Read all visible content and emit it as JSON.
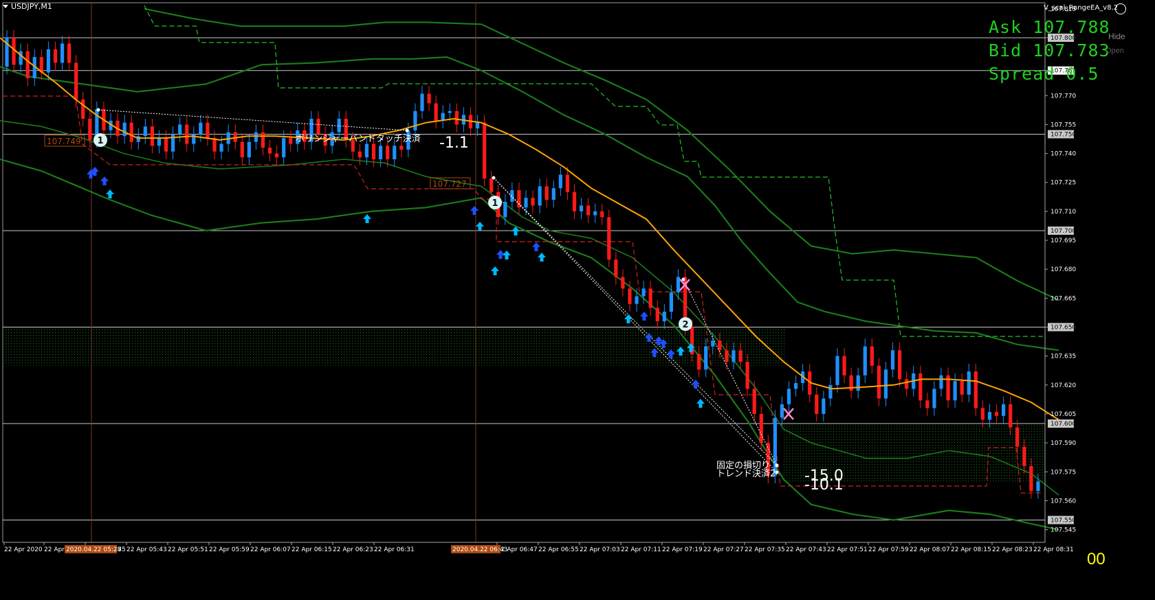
{
  "window": {
    "symbol_label": "USDJPY,M1",
    "ea_name": "V_scal_RangeEA_v8.2"
  },
  "quote_panel": {
    "ask": "Ask 107.788",
    "bid": "Bid 107.783",
    "spread": "Spread 0.5",
    "hide": "Hide",
    "open": "Open"
  },
  "price_axis": {
    "min": 107.542,
    "max": 107.816,
    "labels": [
      "107.815",
      "107.800",
      "107.783",
      "107.770",
      "107.755",
      "107.740",
      "107.725",
      "107.710",
      "107.695",
      "107.680",
      "107.665",
      "107.650",
      "107.635",
      "107.620",
      "107.605",
      "107.590",
      "107.575",
      "107.560",
      "107.545"
    ],
    "boxed": [
      "107.800",
      "107.783",
      "107.750",
      "107.700",
      "107.650",
      "107.600",
      "107.550"
    ]
  },
  "time_axis": {
    "labels": [
      "22 Apr 2020",
      "22 Apr",
      "22 Apr 05:35",
      "22 Apr 05:43",
      "22 Apr 05:51",
      "22 Apr 05:59",
      "22 Apr 06:07",
      "22 Apr 06:15",
      "22 Apr 06:23",
      "22 Apr 06:31",
      "22 Apr 06:47",
      "22 Apr 06:55",
      "22 Apr 07:03",
      "22 Apr 07:11",
      "22 Apr 07:19",
      "22 Apr 07:27",
      "22 Apr 07:35",
      "22 Apr 07:43",
      "22 Apr 07:51",
      "22 Apr 07:59",
      "22 Apr 08:07",
      "22 Apr 08:15",
      "22 Apr 08:23",
      "22 Apr 08:31"
    ],
    "highlight_1": "2020.04.22 05:28",
    "highlight_1_suffix": "7",
    "highlight_2": "2020.04.22 06:43"
  },
  "annotations": {
    "price_tag_1": "107.749",
    "price_tag_2": "107.727",
    "exit_label_1": "ボリンジャーバンドタッチ決済",
    "profit_1": "-1.1",
    "stop_label": "固定の損切り",
    "trend_label": "トレンド決済2",
    "profit_2": "-15.0",
    "profit_3": "-10.1",
    "badge_1": "1",
    "badge_2": "1",
    "badge_3": "2",
    "counter": "00"
  },
  "colors": {
    "up_candle": "#1e90ff",
    "down_candle": "#ff1a1a",
    "ma": "#ffa500",
    "band": "#1a7a1a",
    "grid": "#c8c8c8",
    "quote": "#1fd01f"
  },
  "chart_data": {
    "type": "candlestick",
    "symbol": "USDJPY",
    "timeframe": "M1",
    "ylim": [
      107.542,
      107.816
    ],
    "ma_line": [
      [
        0,
        107.8
      ],
      [
        40,
        107.788
      ],
      [
        80,
        107.777
      ],
      [
        110,
        107.768
      ],
      [
        140,
        107.76
      ],
      [
        170,
        107.753
      ],
      [
        200,
        107.748
      ],
      [
        240,
        107.748
      ],
      [
        280,
        107.749
      ],
      [
        320,
        107.747
      ],
      [
        360,
        107.749
      ],
      [
        400,
        107.749
      ],
      [
        450,
        107.748
      ],
      [
        500,
        107.747
      ],
      [
        540,
        107.749
      ],
      [
        580,
        107.752
      ],
      [
        620,
        107.756
      ],
      [
        660,
        107.758
      ],
      [
        700,
        107.756
      ],
      [
        740,
        107.75
      ],
      [
        780,
        107.742
      ],
      [
        820,
        107.733
      ],
      [
        860,
        107.722
      ],
      [
        900,
        107.714
      ],
      [
        940,
        107.706
      ],
      [
        980,
        107.69
      ],
      [
        1020,
        107.675
      ],
      [
        1060,
        107.66
      ],
      [
        1100,
        107.645
      ],
      [
        1140,
        107.632
      ],
      [
        1180,
        107.621
      ],
      [
        1210,
        107.618
      ],
      [
        1260,
        107.619
      ],
      [
        1300,
        107.62
      ],
      [
        1340,
        107.623
      ],
      [
        1380,
        107.623
      ],
      [
        1420,
        107.622
      ],
      [
        1460,
        107.617
      ],
      [
        1500,
        107.611
      ],
      [
        1540,
        107.602
      ]
    ],
    "upper_band": [
      [
        0,
        107.785
      ],
      [
        40,
        107.78
      ],
      [
        100,
        107.777
      ],
      [
        200,
        107.772
      ],
      [
        300,
        107.776
      ],
      [
        380,
        107.786
      ],
      [
        460,
        107.787
      ],
      [
        540,
        107.789
      ],
      [
        600,
        107.789
      ],
      [
        650,
        107.79
      ],
      [
        700,
        107.783
      ],
      [
        760,
        107.772
      ],
      [
        820,
        107.76
      ],
      [
        880,
        107.75
      ],
      [
        940,
        107.738
      ],
      [
        1000,
        107.728
      ],
      [
        1040,
        107.713
      ],
      [
        1080,
        107.694
      ],
      [
        1120,
        107.678
      ],
      [
        1160,
        107.663
      ],
      [
        1200,
        107.658
      ],
      [
        1260,
        107.653
      ],
      [
        1300,
        107.651
      ],
      [
        1360,
        107.648
      ],
      [
        1420,
        107.647
      ],
      [
        1480,
        107.641
      ],
      [
        1540,
        107.638
      ]
    ],
    "lower_band": [
      [
        0,
        107.737
      ],
      [
        60,
        107.731
      ],
      [
        120,
        107.722
      ],
      [
        160,
        107.716
      ],
      [
        220,
        107.708
      ],
      [
        300,
        107.7
      ],
      [
        380,
        107.704
      ],
      [
        460,
        107.706
      ],
      [
        540,
        107.71
      ],
      [
        620,
        107.712
      ],
      [
        700,
        107.717
      ],
      [
        740,
        107.704
      ],
      [
        800,
        107.694
      ],
      [
        860,
        107.686
      ],
      [
        920,
        107.67
      ],
      [
        980,
        107.651
      ],
      [
        1040,
        107.625
      ],
      [
        1090,
        107.6
      ],
      [
        1140,
        107.571
      ],
      [
        1180,
        107.558
      ],
      [
        1240,
        107.553
      ],
      [
        1300,
        107.55
      ],
      [
        1380,
        107.555
      ],
      [
        1440,
        107.553
      ],
      [
        1500,
        107.548
      ],
      [
        1540,
        107.545
      ]
    ],
    "outer_upper_band": [
      [
        210,
        107.815
      ],
      [
        280,
        107.81
      ],
      [
        350,
        107.806
      ],
      [
        420,
        107.806
      ],
      [
        500,
        107.806
      ],
      [
        560,
        107.808
      ],
      [
        620,
        107.808
      ],
      [
        700,
        107.807
      ],
      [
        760,
        107.797
      ],
      [
        820,
        107.787
      ],
      [
        880,
        107.778
      ],
      [
        940,
        107.768
      ],
      [
        1000,
        107.752
      ],
      [
        1060,
        107.732
      ],
      [
        1120,
        107.71
      ],
      [
        1180,
        107.692
      ],
      [
        1240,
        107.688
      ],
      [
        1300,
        107.69
      ],
      [
        1360,
        107.688
      ],
      [
        1420,
        107.686
      ],
      [
        1480,
        107.674
      ],
      [
        1540,
        107.664
      ]
    ],
    "inner_lower_band": [
      [
        0,
        107.757
      ],
      [
        60,
        107.754
      ],
      [
        120,
        107.748
      ],
      [
        180,
        107.74
      ],
      [
        240,
        107.735
      ],
      [
        320,
        107.732
      ],
      [
        420,
        107.734
      ],
      [
        500,
        107.737
      ],
      [
        560,
        107.735
      ],
      [
        620,
        107.728
      ],
      [
        700,
        107.723
      ],
      [
        760,
        107.707
      ],
      [
        800,
        107.7
      ],
      [
        860,
        107.696
      ],
      [
        920,
        107.686
      ],
      [
        980,
        107.668
      ],
      [
        1040,
        107.645
      ],
      [
        1100,
        107.618
      ],
      [
        1140,
        107.597
      ],
      [
        1180,
        107.59
      ],
      [
        1260,
        107.582
      ],
      [
        1320,
        107.582
      ],
      [
        1380,
        107.586
      ],
      [
        1440,
        107.583
      ],
      [
        1500,
        107.574
      ],
      [
        1540,
        107.563
      ]
    ],
    "candles": [
      [
        107.785,
        107.8
      ],
      [
        107.8,
        107.786
      ],
      [
        107.786,
        107.793
      ],
      [
        107.793,
        107.779
      ],
      [
        107.779,
        107.79
      ],
      [
        107.79,
        107.782
      ],
      [
        107.782,
        107.794
      ],
      [
        107.794,
        107.787
      ],
      [
        107.787,
        107.797
      ],
      [
        107.797,
        107.787
      ],
      [
        107.787,
        107.768
      ],
      [
        107.768,
        107.758
      ],
      [
        107.758,
        107.747
      ],
      [
        107.747,
        107.763
      ],
      [
        107.763,
        107.752
      ],
      [
        107.752,
        107.757
      ],
      [
        107.757,
        107.749
      ],
      [
        107.749,
        107.756
      ],
      [
        107.756,
        107.746
      ],
      [
        107.746,
        107.749
      ],
      [
        107.749,
        107.754
      ],
      [
        107.754,
        107.744
      ],
      [
        107.744,
        107.748
      ],
      [
        107.748,
        107.741
      ],
      [
        107.741,
        107.75
      ],
      [
        107.75,
        107.755
      ],
      [
        107.755,
        107.745
      ],
      [
        107.745,
        107.75
      ],
      [
        107.75,
        107.756
      ],
      [
        107.756,
        107.748
      ],
      [
        107.748,
        107.741
      ],
      [
        107.741,
        107.745
      ],
      [
        107.745,
        107.751
      ],
      [
        107.751,
        107.746
      ],
      [
        107.746,
        107.738
      ],
      [
        107.738,
        107.746
      ],
      [
        107.746,
        107.751
      ],
      [
        107.751,
        107.743
      ],
      [
        107.743,
        107.74
      ],
      [
        107.74,
        107.738
      ],
      [
        107.738,
        107.748
      ],
      [
        107.748,
        107.745
      ],
      [
        107.745,
        107.752
      ],
      [
        107.752,
        107.746
      ],
      [
        107.746,
        107.758
      ],
      [
        107.758,
        107.75
      ],
      [
        107.75,
        107.744
      ],
      [
        107.744,
        107.751
      ],
      [
        107.751,
        107.758
      ],
      [
        107.758,
        107.747
      ],
      [
        107.747,
        107.741
      ],
      [
        107.741,
        107.738
      ],
      [
        107.738,
        107.745
      ],
      [
        107.745,
        107.737
      ],
      [
        107.737,
        107.744
      ],
      [
        107.744,
        107.737
      ],
      [
        107.737,
        107.744
      ],
      [
        107.744,
        107.742
      ],
      [
        107.742,
        107.752
      ],
      [
        107.752,
        107.762
      ],
      [
        107.762,
        107.771
      ],
      [
        107.771,
        107.766
      ],
      [
        107.766,
        107.757
      ],
      [
        107.757,
        107.761
      ],
      [
        107.761,
        107.762
      ],
      [
        107.762,
        107.755
      ],
      [
        107.755,
        107.76
      ],
      [
        107.76,
        107.753
      ],
      [
        107.753,
        107.756
      ],
      [
        107.756,
        107.727
      ],
      [
        107.727,
        107.72
      ],
      [
        107.72,
        107.707
      ],
      [
        107.707,
        107.715
      ],
      [
        107.715,
        107.721
      ],
      [
        107.721,
        107.712
      ],
      [
        107.712,
        107.717
      ],
      [
        107.717,
        107.713
      ],
      [
        107.713,
        107.723
      ],
      [
        107.723,
        107.716
      ],
      [
        107.716,
        107.722
      ],
      [
        107.722,
        107.729
      ],
      [
        107.729,
        107.72
      ],
      [
        107.72,
        107.71
      ],
      [
        107.71,
        107.713
      ],
      [
        107.713,
        107.708
      ],
      [
        107.708,
        107.71
      ],
      [
        107.71,
        107.707
      ],
      [
        107.707,
        107.685
      ],
      [
        107.685,
        107.676
      ],
      [
        107.676,
        107.67
      ],
      [
        107.67,
        107.662
      ],
      [
        107.662,
        107.666
      ],
      [
        107.666,
        107.67
      ],
      [
        107.67,
        107.66
      ],
      [
        107.66,
        107.653
      ],
      [
        107.653,
        107.658
      ],
      [
        107.658,
        107.668
      ],
      [
        107.668,
        107.676
      ],
      [
        107.676,
        107.65
      ],
      [
        107.65,
        107.636
      ],
      [
        107.636,
        107.628
      ],
      [
        107.628,
        107.64
      ],
      [
        107.64,
        107.643
      ],
      [
        107.643,
        107.638
      ],
      [
        107.638,
        107.632
      ],
      [
        107.632,
        107.638
      ],
      [
        107.638,
        107.632
      ],
      [
        107.632,
        107.618
      ],
      [
        107.618,
        107.605
      ],
      [
        107.605,
        107.59
      ],
      [
        107.59,
        107.573
      ],
      [
        107.573,
        107.603
      ],
      [
        107.603,
        107.61
      ],
      [
        107.61,
        107.618
      ],
      [
        107.618,
        107.621
      ],
      [
        107.621,
        107.627
      ],
      [
        107.627,
        107.615
      ],
      [
        107.615,
        107.605
      ],
      [
        107.605,
        107.613
      ],
      [
        107.613,
        107.62
      ],
      [
        107.62,
        107.635
      ],
      [
        107.635,
        107.625
      ],
      [
        107.625,
        107.617
      ],
      [
        107.617,
        107.625
      ],
      [
        107.625,
        107.64
      ],
      [
        107.64,
        107.63
      ],
      [
        107.63,
        107.613
      ],
      [
        107.613,
        107.628
      ],
      [
        107.628,
        107.638
      ],
      [
        107.638,
        107.623
      ],
      [
        107.623,
        107.618
      ],
      [
        107.618,
        107.626
      ],
      [
        107.626,
        107.612
      ],
      [
        107.612,
        107.608
      ],
      [
        107.608,
        107.618
      ],
      [
        107.618,
        107.625
      ],
      [
        107.625,
        107.612
      ],
      [
        107.612,
        107.622
      ],
      [
        107.622,
        107.615
      ],
      [
        107.615,
        107.627
      ],
      [
        107.627,
        107.608
      ],
      [
        107.608,
        107.602
      ],
      [
        107.602,
        107.606
      ],
      [
        107.606,
        107.604
      ],
      [
        107.604,
        107.61
      ],
      [
        107.61,
        107.598
      ],
      [
        107.598,
        107.588
      ],
      [
        107.588,
        107.578
      ],
      [
        107.578,
        107.565
      ],
      [
        107.565,
        107.57
      ]
    ]
  }
}
